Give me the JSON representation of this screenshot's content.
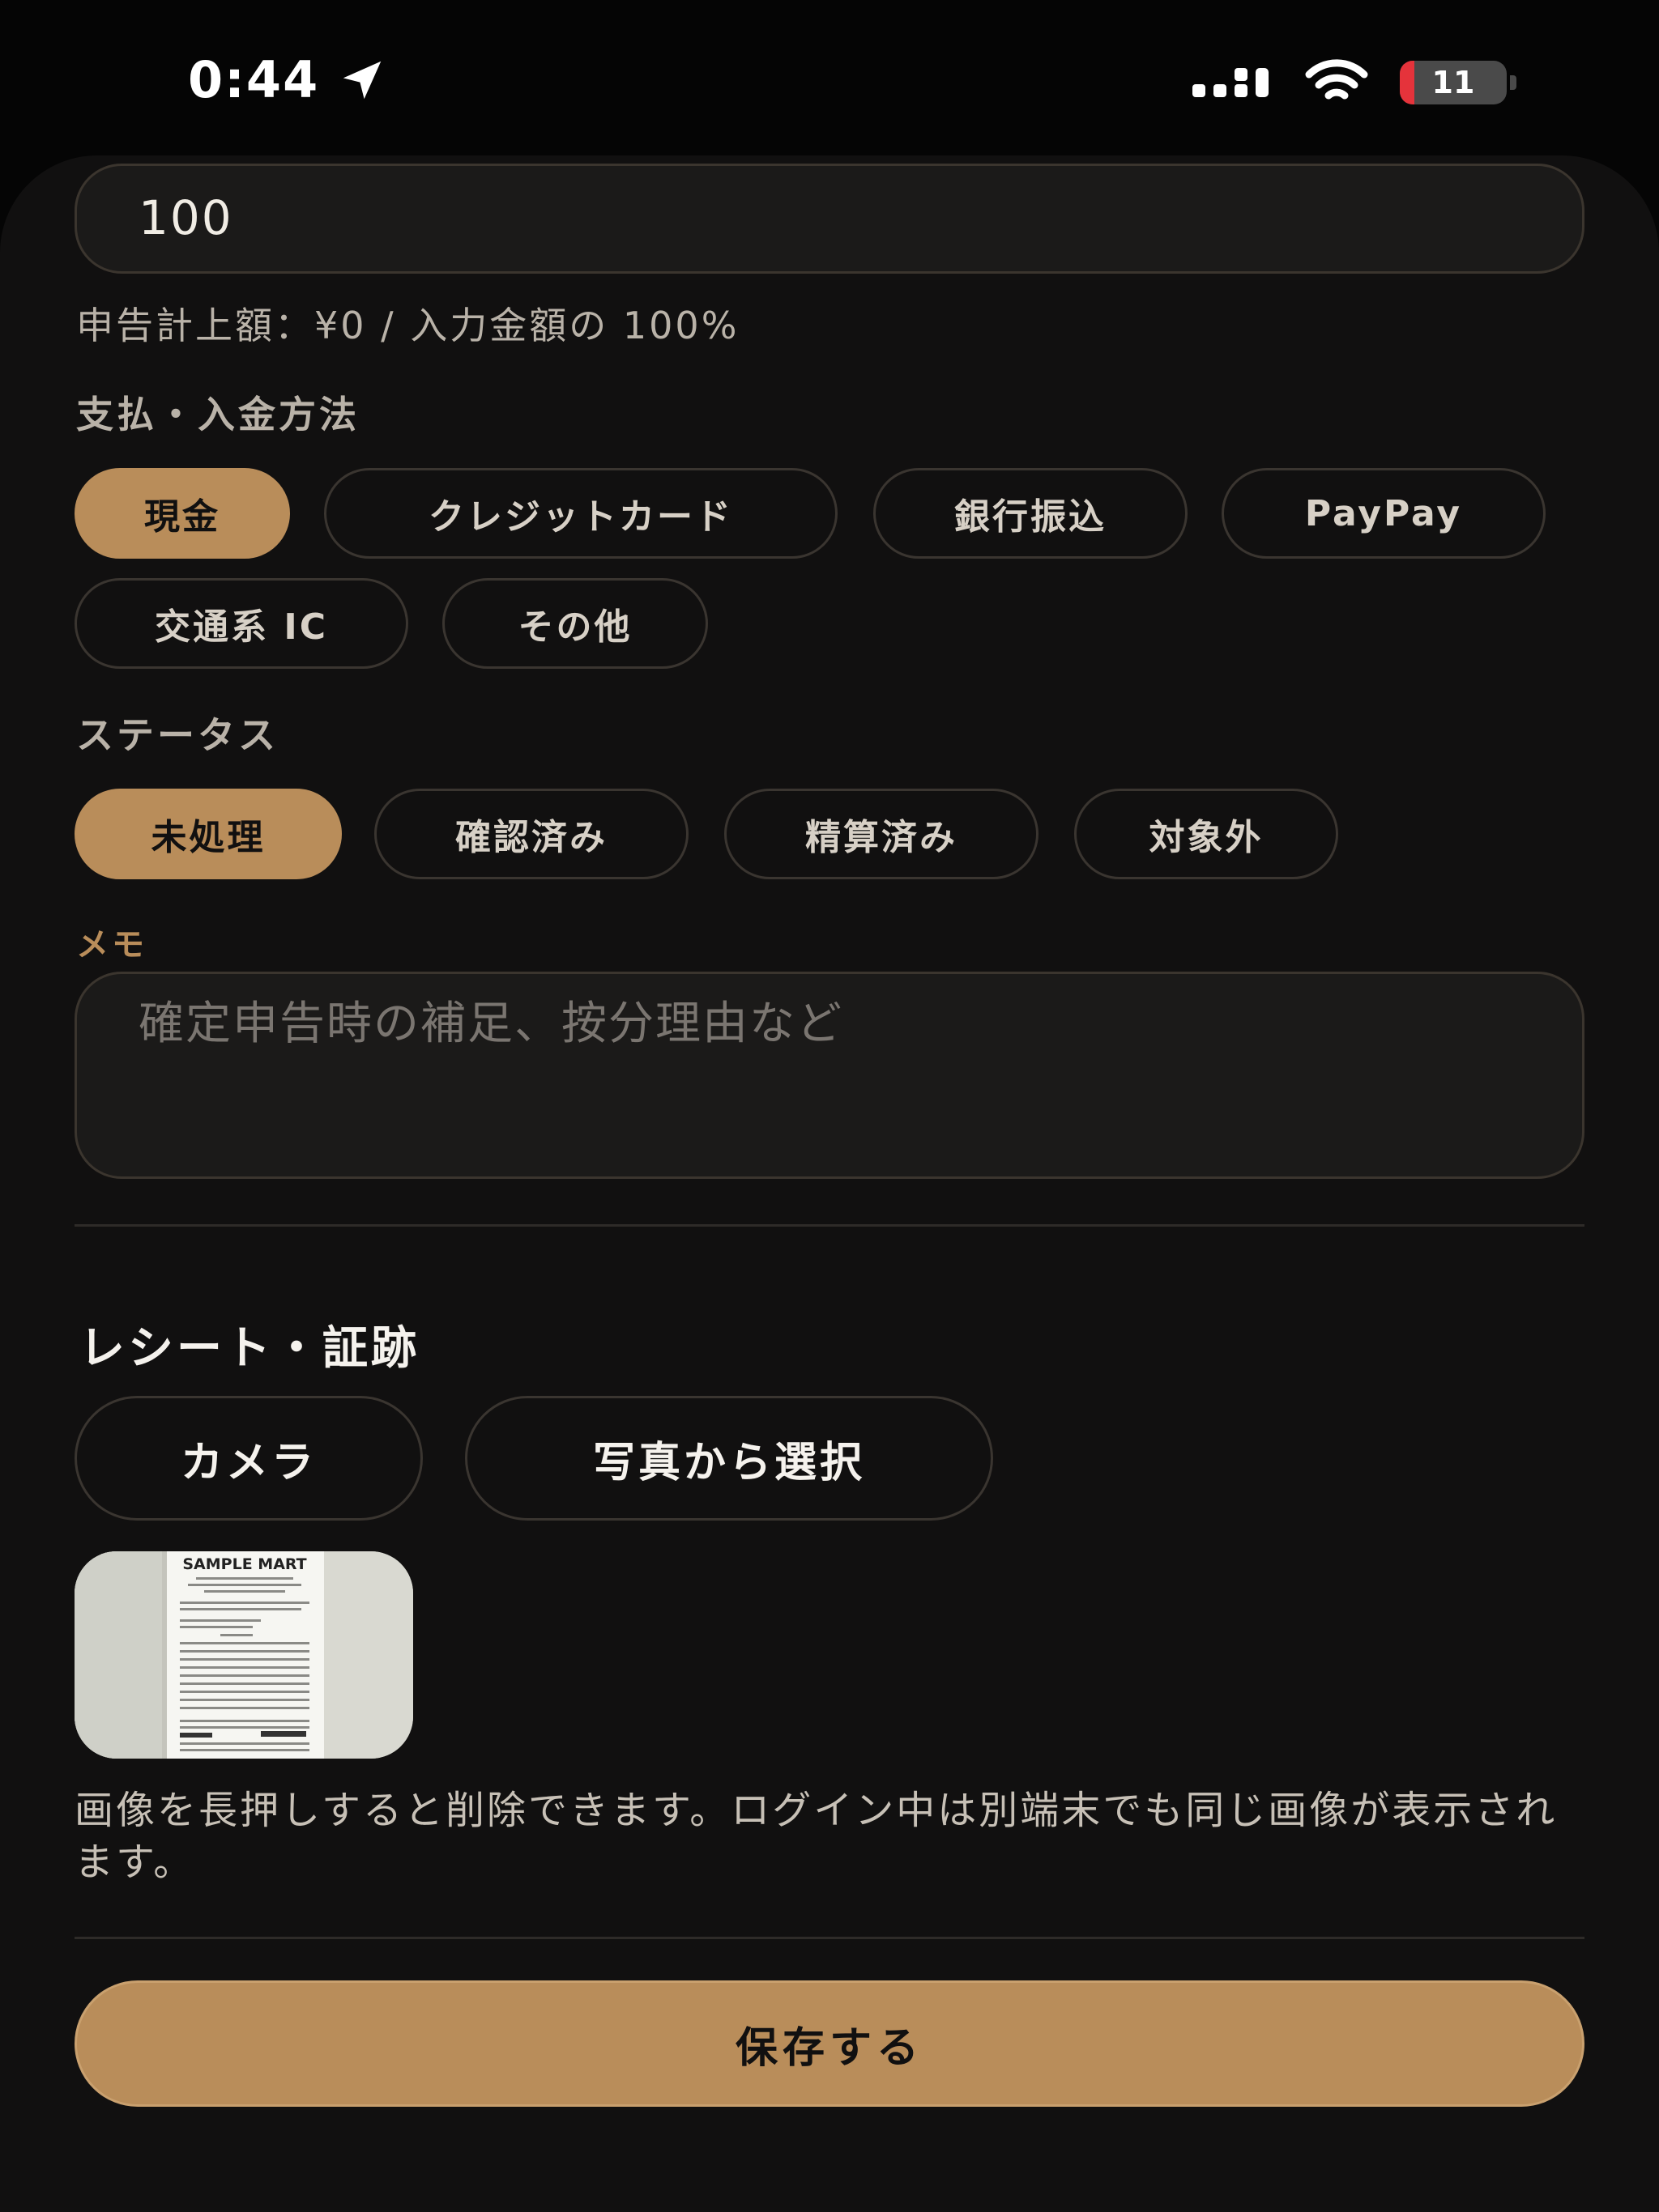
{
  "status_bar": {
    "time": "0:44",
    "battery_level": "11"
  },
  "amount": {
    "value": "100",
    "caption": "申告計上額：¥0 / 入力金額の 100%"
  },
  "payment": {
    "label": "支払・入金方法",
    "options": [
      "現金",
      "クレジットカード",
      "銀行振込",
      "PayPay",
      "交通系 IC",
      "その他"
    ],
    "selected": "現金"
  },
  "status": {
    "label": "ステータス",
    "options": [
      "未処理",
      "確認済み",
      "精算済み",
      "対象外"
    ],
    "selected": "未処理"
  },
  "memo": {
    "label": "メモ",
    "placeholder": "確定申告時の補足、按分理由など"
  },
  "receipt": {
    "title": "レシート・証跡",
    "camera_label": "カメラ",
    "photo_label": "写真から選択",
    "thumbnail_text": "SAMPLE MART",
    "help_text": "画像を長押しすると削除できます。ログイン中は別端末でも同じ画像が表示されます。"
  },
  "save_label": "保存する",
  "colors": {
    "accent": "#b98d5a",
    "background": "#111010",
    "battery_low": "#e5333b"
  }
}
